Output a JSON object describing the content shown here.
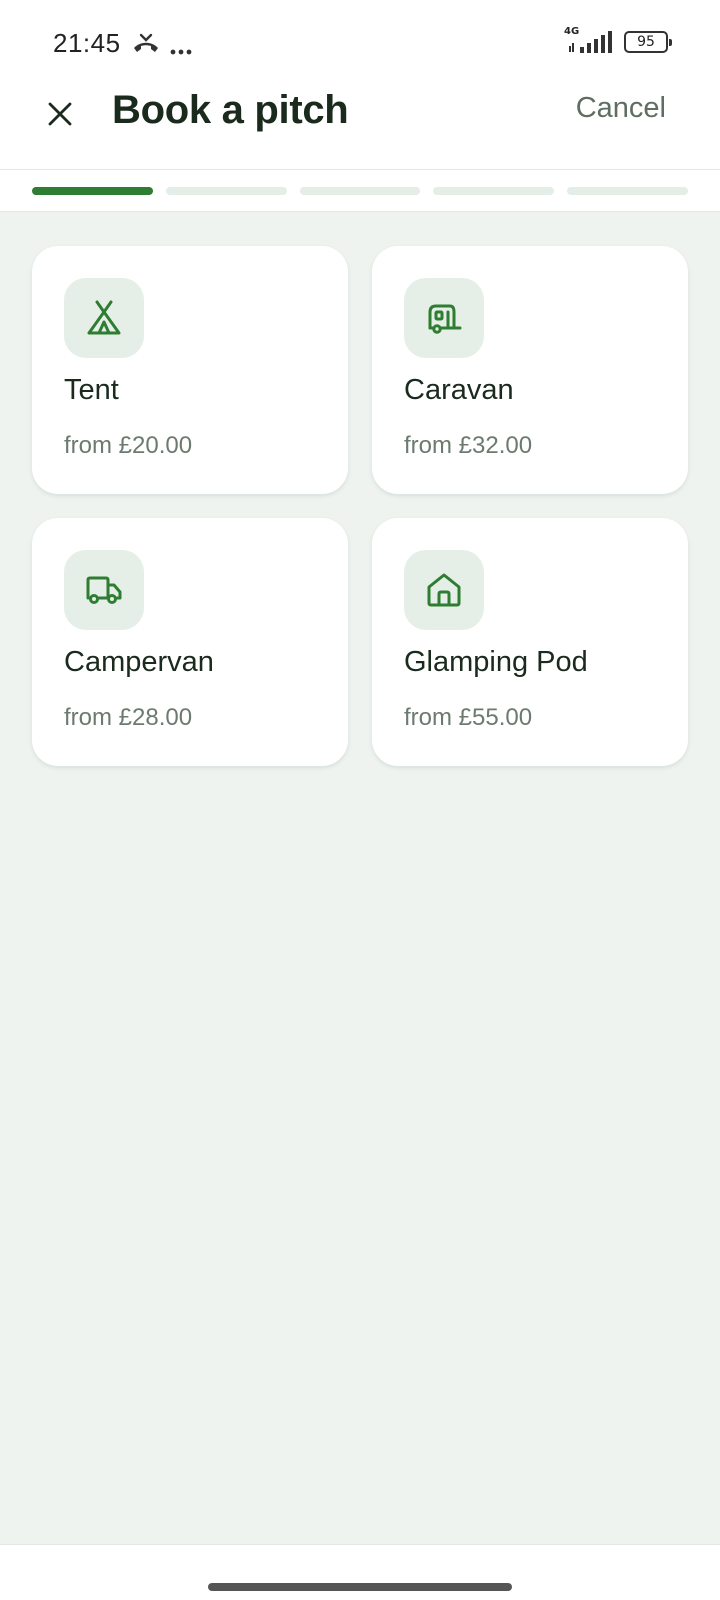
{
  "status_bar": {
    "time": "21:45",
    "network": "4G",
    "battery": "95"
  },
  "header": {
    "title": "Book a pitch",
    "cancel_label": "Cancel",
    "close_icon": "close-icon"
  },
  "progress": {
    "total_steps": 5,
    "current_step": 1
  },
  "pitches": [
    {
      "name": "Tent",
      "price": "from £20.00",
      "icon": "tent-icon"
    },
    {
      "name": "Caravan",
      "price": "from £32.00",
      "icon": "caravan-icon"
    },
    {
      "name": "Campervan",
      "price": "from £28.00",
      "icon": "truck-icon"
    },
    {
      "name": "Glamping Pod",
      "price": "from £55.00",
      "icon": "home-icon"
    }
  ],
  "colors": {
    "accent": "#2e7d32",
    "background": "#eef3ef",
    "icon_tile": "#e6efe7"
  }
}
